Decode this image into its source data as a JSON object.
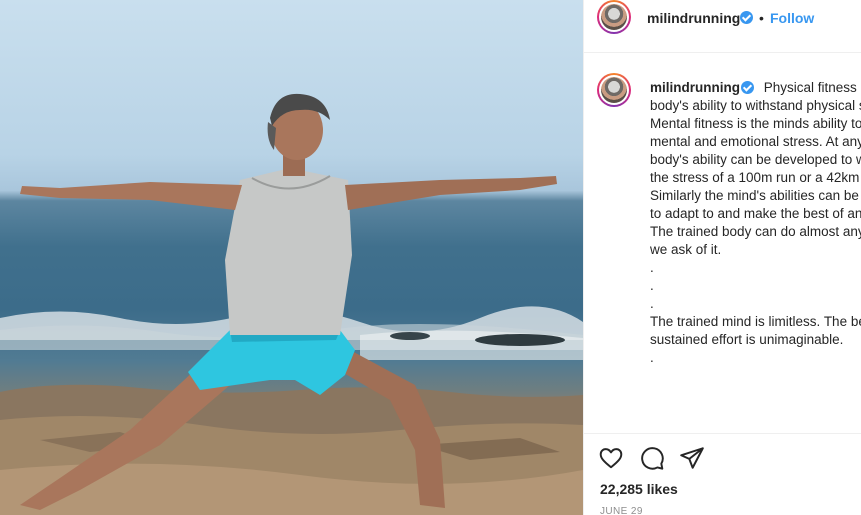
{
  "post": {
    "username": "milindrunning",
    "follow_label": "Follow",
    "separator": "•",
    "caption_user": "milindrunning",
    "caption_text": "Physical fitness is the body's ability to withstand physical stress. Mental fitness is the minds ability to withstand mental and emotional stress. At any age, the body's ability can be developed to withstand the stress of a 100m run or a 42km marathon. Similarly the mind's abilities can be developed to adapt to and make the best of any situation. The trained body can do almost anything that we ask of it.\n.\n.\n.\nThe trained mind is limitless. The benefit of sustained effort is unimaginable.\n.",
    "likes": "22,285 likes",
    "date": "JUNE 29"
  },
  "icons": {
    "like": "heart-icon",
    "comment": "comment-icon",
    "share": "share-icon",
    "verified": "verified-badge-icon"
  },
  "colors": {
    "accent": "#3897f0",
    "text": "#262626",
    "muted": "#8e8e8e"
  }
}
